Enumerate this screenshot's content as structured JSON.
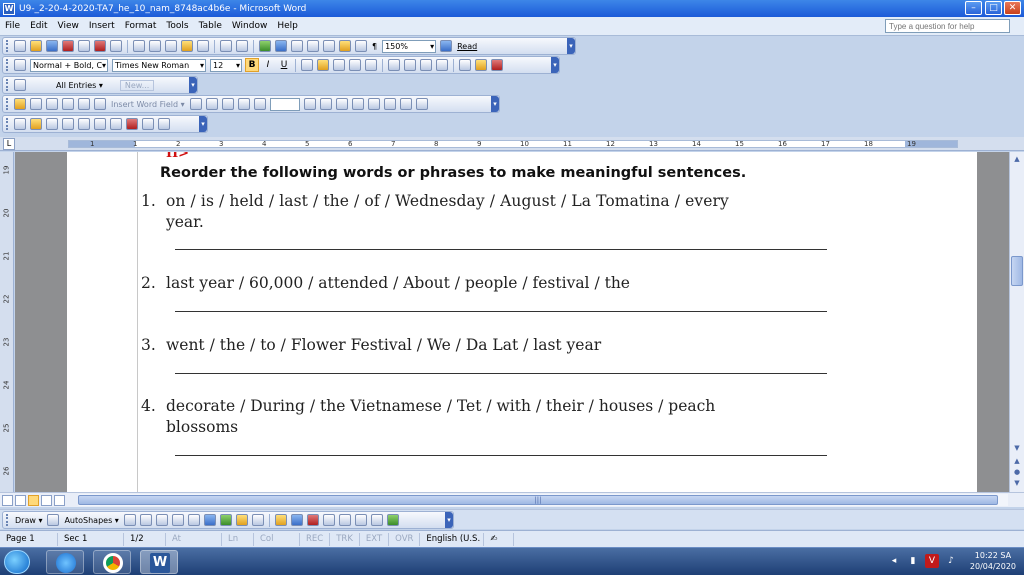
{
  "window": {
    "title": "U9-_2-20-4-2020-TA7_he_10_nam_8748ac4b6e - Microsoft Word",
    "min": "–",
    "max": "□",
    "close": "✕"
  },
  "menu": {
    "items": [
      "File",
      "Edit",
      "View",
      "Insert",
      "Format",
      "Tools",
      "Table",
      "Window",
      "Help"
    ],
    "help_placeholder": "Type a question for help"
  },
  "standard_toolbar": {
    "zoom": "150%",
    "read_label": "Read"
  },
  "formatting_toolbar": {
    "style": "Normal + Bold, C",
    "font": "Times New Roman",
    "size": "12",
    "bold": "B",
    "italic": "I",
    "underline": "U"
  },
  "autotext_toolbar": {
    "entries_label": "All Entries ▾",
    "new_label": "New..."
  },
  "mailmerge_toolbar": {
    "insert_word_field": "Insert Word Field ▾"
  },
  "document": {
    "red_mark": "II>",
    "heading": "Reorder the following words or phrases to make meaningful sentences.",
    "items": [
      {
        "num": "1.",
        "line1": "on / is / held / last / the / of / Wednesday / August  / La Tomatina / every",
        "line2": "year."
      },
      {
        "num": "2.",
        "line1": "last year / 60,000 / attended / About / people / festival / the",
        "line2": ""
      },
      {
        "num": "3.",
        "line1": "went / the / to / Flower Festival / We / Da Lat / last year",
        "line2": ""
      },
      {
        "num": "4.",
        "line1": "decorate / During / the Vietnamese / Tet / with / their / houses / peach",
        "line2": "blossoms"
      }
    ]
  },
  "ruler": {
    "h_numbers": [
      "1",
      "1",
      "2",
      "3",
      "4",
      "5",
      "6",
      "7",
      "8",
      "9",
      "10",
      "11",
      "12",
      "13",
      "14",
      "15",
      "16",
      "17",
      "18",
      "19"
    ],
    "v_numbers": [
      "19",
      "20",
      "21",
      "22",
      "23",
      "24",
      "25",
      "26"
    ]
  },
  "drawing_toolbar": {
    "draw_label": "Draw ▾",
    "autoshapes_label": "AutoShapes ▾"
  },
  "status": {
    "page": "Page 1",
    "sec": "Sec 1",
    "pages": "1/2",
    "at": "At",
    "ln": "Ln",
    "col": "Col",
    "rec": "REC",
    "trk": "TRK",
    "ext": "EXT",
    "ovr": "OVR",
    "lang": "English (U.S."
  },
  "taskbar": {
    "time": "10:22 SA",
    "date": "20/04/2020"
  },
  "colors": {
    "title_bar": "#2a64d8",
    "word_accent": "#2b579a",
    "heading_red": "#d01010"
  }
}
